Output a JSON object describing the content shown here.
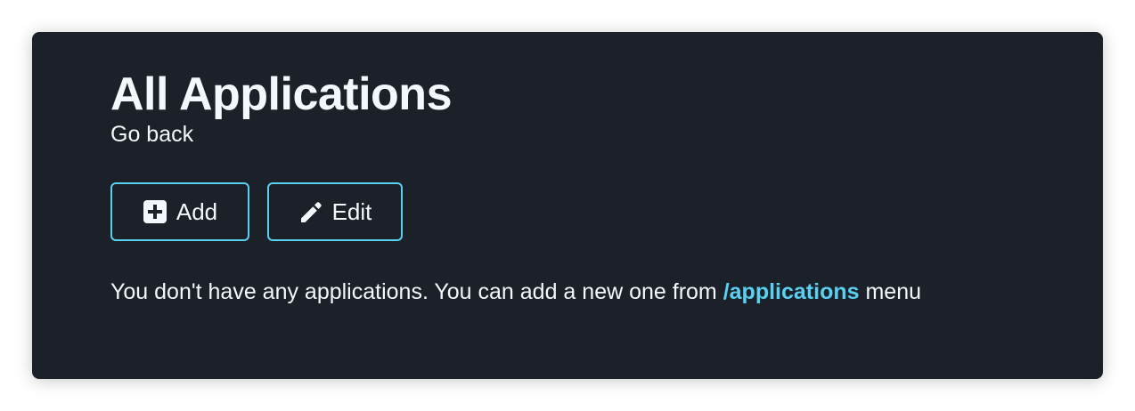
{
  "page": {
    "title": "All Applications",
    "back_link": "Go back"
  },
  "actions": {
    "add_label": "Add",
    "add_icon": "plus-square-icon",
    "edit_label": "Edit",
    "edit_icon": "pencil-icon"
  },
  "empty_state": {
    "text_before": "You don't have any applications. You can add a new one from ",
    "link_text": "/applications",
    "text_after": " menu"
  },
  "colors": {
    "card_background": "#1c2028",
    "accent": "#5ad0f0",
    "text": "#f4f7fb"
  }
}
